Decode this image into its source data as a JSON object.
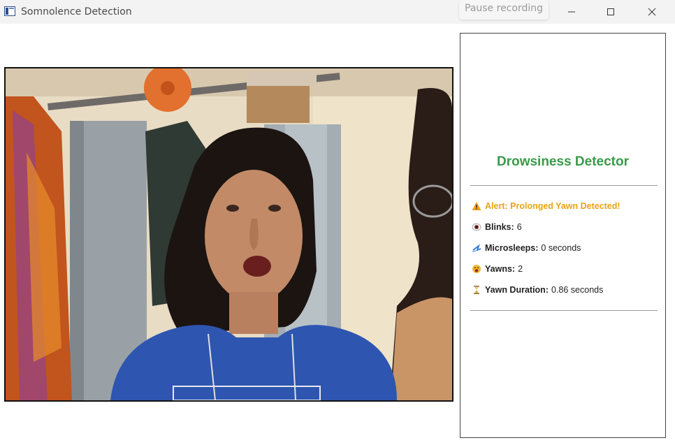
{
  "window": {
    "title": "Somnolence Detection",
    "pause_label": "Pause recording"
  },
  "panel": {
    "title": "Drowsiness Detector",
    "alert": {
      "icon": "warning-icon",
      "text": "Alert: Prolonged Yawn Detected!"
    },
    "stats": {
      "blinks": {
        "icon": "eye-icon",
        "label": "Blinks:",
        "value": "6"
      },
      "microsleeps": {
        "icon": "sleep-icon",
        "label": "Microsleeps:",
        "value": "0 seconds"
      },
      "yawns": {
        "icon": "yawn-face-icon",
        "label": "Yawns:",
        "value": "2"
      },
      "yawn_duration": {
        "icon": "hourglass-icon",
        "label": "Yawn Duration:",
        "value": "0.86 seconds"
      }
    }
  },
  "colors": {
    "title_green": "#3a9a4a",
    "alert_amber": "#e8a317"
  }
}
